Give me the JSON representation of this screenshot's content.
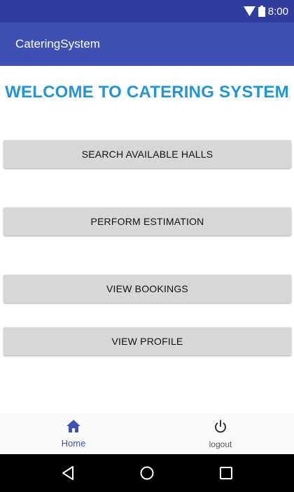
{
  "status_bar": {
    "time": "8:00",
    "icons": [
      "wifi-icon",
      "battery-icon"
    ]
  },
  "app_bar": {
    "title": "CateringSystem"
  },
  "main": {
    "welcome_text": "WELCOME TO CATERING SYSTEM",
    "buttons": [
      {
        "label": "SEARCH AVAILABLE HALLS"
      },
      {
        "label": "PERFORM ESTIMATION"
      },
      {
        "label": "VIEW BOOKINGS"
      },
      {
        "label": "VIEW PROFILE"
      }
    ]
  },
  "bottom_nav": {
    "items": [
      {
        "label": "Home",
        "icon": "home-icon",
        "active": true
      },
      {
        "label": "logout",
        "icon": "power-icon",
        "active": false
      }
    ]
  },
  "system_nav": {
    "icons": [
      "back-icon",
      "home-circle-icon",
      "recents-icon"
    ]
  },
  "colors": {
    "status_bar": "#303f9f",
    "app_bar": "#3f51b5",
    "welcome_text": "#2196d3",
    "button_bg": "#d6d7d7",
    "nav_active": "#3f51b5"
  }
}
